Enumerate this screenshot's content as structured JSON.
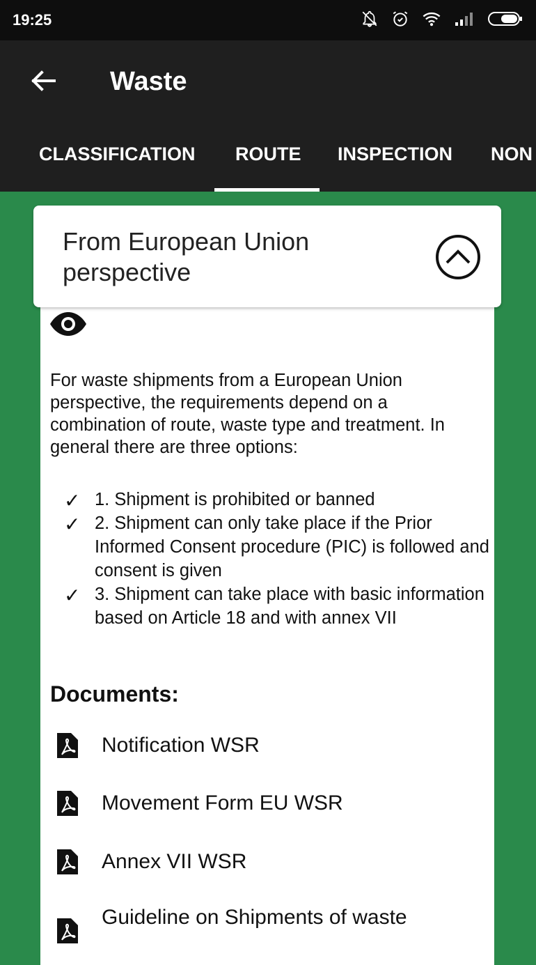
{
  "status_bar": {
    "time": "19:25"
  },
  "app_bar": {
    "title": "Waste"
  },
  "tabs": [
    {
      "label": "CLASSIFICATION"
    },
    {
      "label": "ROUTE"
    },
    {
      "label": "INSPECTION"
    },
    {
      "label": "NON"
    }
  ],
  "active_tab": "ROUTE",
  "section": {
    "title": "From European Union perspective"
  },
  "intro_text": "For waste shipments from a European Union perspective, the requirements depend on a combination of route, waste type and treatment. In general there are three options:",
  "options": [
    {
      "check": "✓",
      "text": "1. Shipment is prohibited or banned"
    },
    {
      "check": "✓",
      "text": "2. Shipment can only take place if the Prior Informed Consent procedure (PIC) is followed and consent is given"
    },
    {
      "check": "✓",
      "text": "3. Shipment can take place with basic information based on Article 18 and with annex VII"
    }
  ],
  "documents": {
    "title": "Documents:",
    "items": [
      {
        "label": "Notification WSR"
      },
      {
        "label": "Movement Form EU WSR"
      },
      {
        "label": "Annex VII WSR"
      },
      {
        "label": "Guideline on Shipments of waste"
      }
    ]
  },
  "colors": {
    "background": "#2a8a4b",
    "app_bar": "#1f1f1f",
    "status_bar": "#0e0e0e"
  },
  "icons": [
    "back-arrow-icon",
    "collapse-up-icon",
    "eye-icon",
    "pdf-icon"
  ]
}
